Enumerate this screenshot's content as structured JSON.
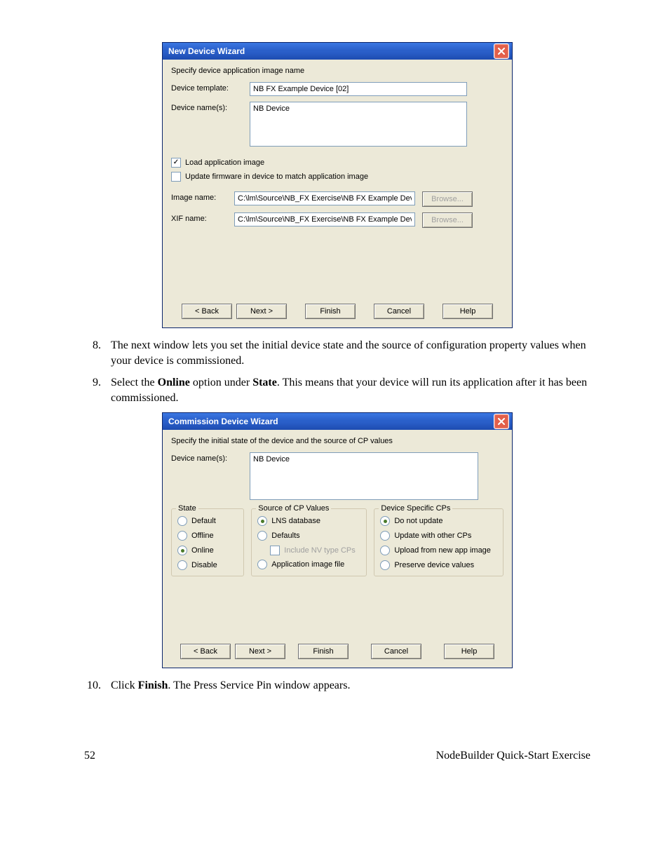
{
  "dialog1": {
    "title": "New Device Wizard",
    "instr": "Specify device application image name",
    "labels": {
      "device_template": "Device template:",
      "device_names": "Device name(s):",
      "image_name": "Image name:",
      "xif_name": "XIF name:"
    },
    "values": {
      "device_template": "NB FX Example Device [02]",
      "device_names": "NB Device",
      "image_name": "C:\\lm\\Source\\NB_FX Exercise\\NB FX Example Device\\De",
      "xif_name": "C:\\lm\\Source\\NB_FX Exercise\\NB FX Example Device\\De"
    },
    "checkboxes": {
      "load_app": "Load application image",
      "update_fw": "Update firmware in device to match application image"
    },
    "buttons": {
      "browse": "Browse...",
      "back": "< Back",
      "next": "Next >",
      "finish": "Finish",
      "cancel": "Cancel",
      "help": "Help"
    }
  },
  "step8": {
    "num": "8.",
    "text_a": "The next window lets you set the initial device state and the source of configuration property values when your device is commissioned."
  },
  "step9": {
    "num": "9.",
    "prefix": "Select the ",
    "bold1": "Online",
    "mid": " option under ",
    "bold2": "State",
    "suffix": ".  This means that your device will run its application after it has been commissioned."
  },
  "dialog2": {
    "title": "Commission Device Wizard",
    "instr": "Specify the initial state of the device and the source of CP values",
    "labels": {
      "device_names": "Device name(s):"
    },
    "values": {
      "device_names": "NB Device"
    },
    "state": {
      "title": "State",
      "default": "Default",
      "offline": "Offline",
      "online": "Online",
      "disable": "Disable"
    },
    "source": {
      "title": "Source of CP Values",
      "lns": "LNS database",
      "defaults": "Defaults",
      "include_nv": "Include NV type CPs",
      "app_file": "Application image file"
    },
    "device_cps": {
      "title": "Device Specific CPs",
      "do_not": "Do not update",
      "update_other": "Update with other CPs",
      "upload_new": "Upload from new app image",
      "preserve": "Preserve device values"
    },
    "buttons": {
      "back": "< Back",
      "next": "Next >",
      "finish": "Finish",
      "cancel": "Cancel",
      "help": "Help"
    }
  },
  "step10": {
    "num": "10.",
    "prefix": "Click ",
    "bold": "Finish",
    "suffix": ".  The Press Service Pin window appears."
  },
  "footer": {
    "page": "52",
    "doc": "NodeBuilder Quick-Start Exercise"
  }
}
